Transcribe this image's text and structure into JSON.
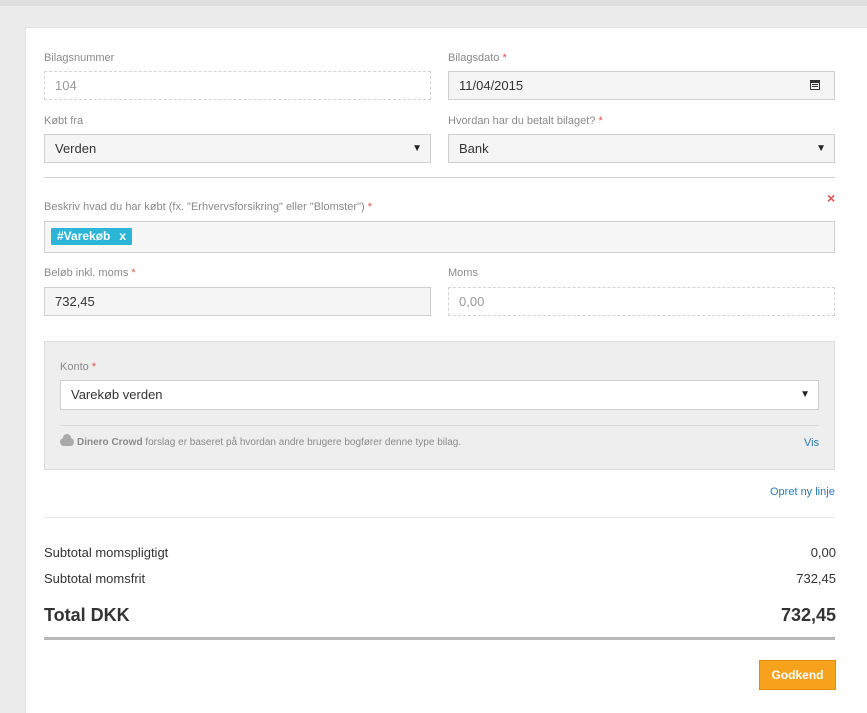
{
  "form": {
    "bilagsnummer": {
      "label": "Bilagsnummer",
      "placeholder": "104"
    },
    "bilagsdato": {
      "label": "Bilagsdato",
      "required": "*",
      "value": "11/04/2015"
    },
    "koebt_fra": {
      "label": "Købt fra",
      "value": "Verden"
    },
    "betalt": {
      "label": "Hvordan har du betalt bilaget?",
      "required": "*",
      "value": "Bank"
    }
  },
  "line": {
    "remove_icon": "×",
    "description_label": "Beskriv hvad du har købt (fx. \"Erhvervsforsikring\" eller \"Blomster\")",
    "required": "*",
    "tag": {
      "label": "#Varekøb",
      "remove": "x"
    },
    "amount": {
      "label": "Beløb inkl. moms",
      "required": "*",
      "value": "732,45"
    },
    "vat": {
      "label": "Moms",
      "placeholder": "0,00"
    },
    "account": {
      "label": "Konto",
      "required": "*",
      "value": "Varekøb verden",
      "crowd_name": "Dinero Crowd",
      "crowd_text": "forslag er baseret på hvordan andre brugere bogfører denne type bilag.",
      "crowd_link": "Vis"
    },
    "new_line_link": "Opret ny linje"
  },
  "summary": {
    "subtotal_vat_label": "Subtotal momspligtigt",
    "subtotal_vat_value": "0,00",
    "subtotal_free_label": "Subtotal momsfrit",
    "subtotal_free_value": "732,45",
    "total_label": "Total DKK",
    "total_value": "732,45"
  },
  "actions": {
    "approve": "Godkend"
  },
  "icons": {
    "calendar": "calendar-icon",
    "select_caret": "caret-down-icon",
    "cloud": "cloud-icon"
  },
  "colors": {
    "accent": "#2bb5d6",
    "approve": "#f7a21c",
    "required": "#d9534f",
    "link": "#2a7ab0"
  }
}
